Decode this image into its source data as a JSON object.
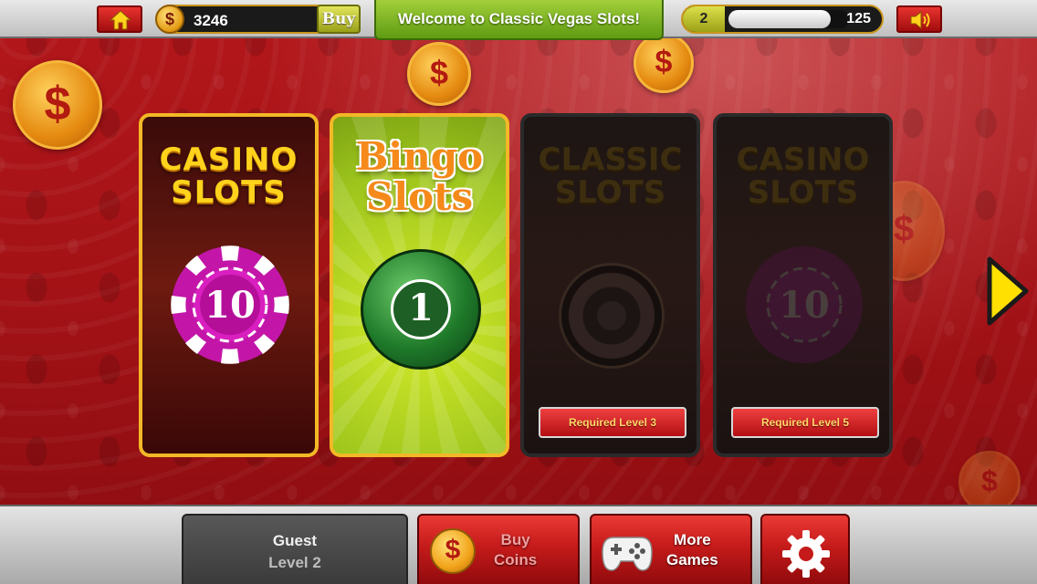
{
  "topbar": {
    "coin_icon": "$",
    "coins": "3246",
    "buy_label": "Buy",
    "welcome": "Welcome to Classic Vegas Slots!",
    "level": "2",
    "xp_value": "125",
    "xp_progress": 0.85
  },
  "cards": [
    {
      "title_line1": "CASINO",
      "title_line2": "SLOTS",
      "chip_value": "10",
      "locked": false
    },
    {
      "title_line1": "Bingo",
      "title_line2": "Slots",
      "ball_value": "1",
      "locked": false
    },
    {
      "title_line1": "CLASSIC",
      "title_line2": "SLOTS",
      "locked": true,
      "requirement": "Required Level 3"
    },
    {
      "title_line1": "CASINO",
      "title_line2": "SLOTS",
      "chip_value": "10",
      "locked": true,
      "requirement": "Required Level 5"
    }
  ],
  "floating_coin_symbol": "$",
  "bottombar": {
    "profile_name": "Guest",
    "profile_level": "Level 2",
    "buy_coins_line1": "Buy",
    "buy_coins_line2": "Coins",
    "buy_coins_icon": "$",
    "more_games_line1": "More",
    "more_games_line2": "Games"
  },
  "colors": {
    "accent_gold": "#f2b826",
    "table_red": "#a31216",
    "button_red": "#c41a1a",
    "welcome_green": "#7ab81f"
  },
  "icons": [
    "home-icon",
    "sound-icon",
    "next-arrow-icon",
    "gamepad-icon",
    "gear-icon"
  ]
}
